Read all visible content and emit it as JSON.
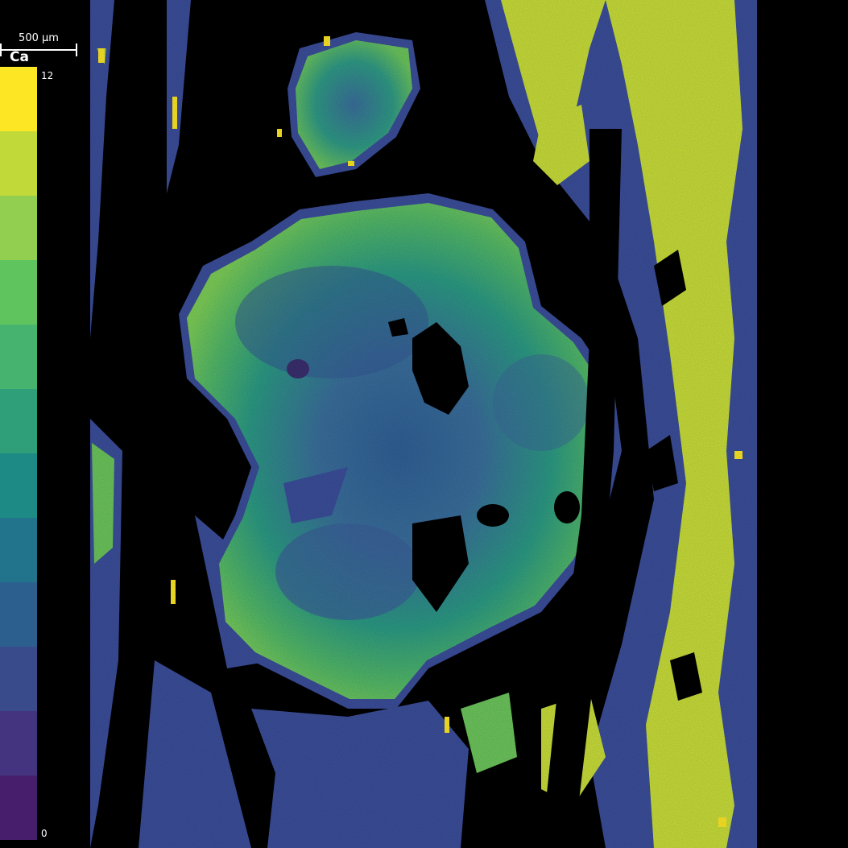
{
  "scale_bar": {
    "label": "500 µm"
  },
  "element": {
    "label": "Ca"
  },
  "colorbar": {
    "max_label": "12",
    "min_label": "0",
    "colors": [
      "#fde725",
      "#c2d93a",
      "#92cf50",
      "#5fc45e",
      "#46b36f",
      "#2e9f78",
      "#1e8a86",
      "#21748c",
      "#2c5f8d",
      "#3a4b8c",
      "#44347f",
      "#461e6b"
    ]
  },
  "map_colors": {
    "background": "#000000",
    "rim": "#3b4e9a",
    "low": "#3a5a9c",
    "mid": "#2a8a8c",
    "high": "#5cc05e",
    "very_high": "#c8dd3a",
    "max": "#fde725"
  }
}
